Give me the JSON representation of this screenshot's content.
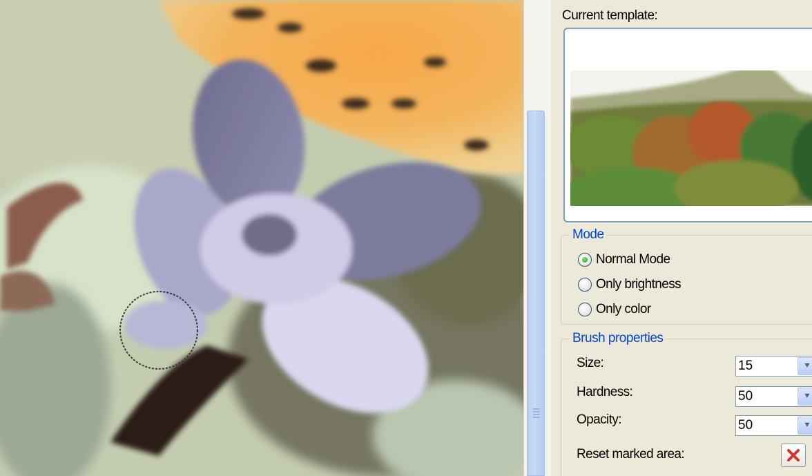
{
  "panel": {
    "current_template_label": "Current template:"
  },
  "mode": {
    "legend": "Mode",
    "options": [
      {
        "label": "Normal Mode",
        "selected": true
      },
      {
        "label": "Only brightness",
        "selected": false
      },
      {
        "label": "Only color",
        "selected": false
      }
    ]
  },
  "brush": {
    "legend": "Brush properties",
    "size": {
      "label": "Size:",
      "value": "15"
    },
    "hardness": {
      "label": "Hardness:",
      "value": "50"
    },
    "opacity": {
      "label": "Opacity:",
      "value": "50"
    },
    "reset_label": "Reset marked area:"
  },
  "icons": {
    "radio": "radio-icon",
    "dropdown": "chevron-down-icon",
    "reset": "red-x-icon",
    "cursor": "brush-cursor-icon"
  },
  "colors": {
    "accent": "#0046d5",
    "selected_radio": "#21a121",
    "reset_x": "#d4342b"
  }
}
